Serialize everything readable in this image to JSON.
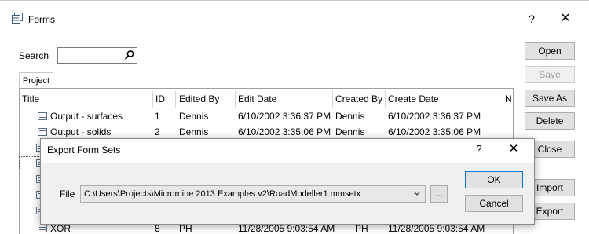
{
  "window": {
    "title": "Forms",
    "help": "?",
    "close": "✕"
  },
  "search": {
    "label": "Search",
    "value": ""
  },
  "tabs": [
    {
      "label": "Project"
    }
  ],
  "table": {
    "columns": [
      "Title",
      "ID",
      "Edited By",
      "Edit Date",
      "Created By",
      "Create Date",
      "N"
    ],
    "rows": [
      {
        "title": "Output - surfaces",
        "id": "1",
        "edited_by": "Dennis",
        "edit_date": "6/10/2002 3:36:37 PM",
        "created_by": "Dennis",
        "create_date": "6/10/2002 3:36:37 PM"
      },
      {
        "title": "Output - solids",
        "id": "2",
        "edited_by": "Dennis",
        "edit_date": "6/10/2002 3:35:06 PM",
        "created_by": "Dennis",
        "create_date": "6/10/2002 3:35:06 PM"
      },
      {
        "title": "XOR",
        "id": "8",
        "edited_by": "PH",
        "edit_date": "11/28/2005 9:03:54 AM",
        "created_by": "PH",
        "create_date": "11/28/2005 9:03:54 AM"
      }
    ]
  },
  "buttons": {
    "open": "Open",
    "save": "Save",
    "save_as": "Save As",
    "delete": "Delete",
    "close": "Close",
    "import": "Import",
    "export": "Export"
  },
  "dialog": {
    "title": "Export Form Sets",
    "help": "?",
    "close": "✕",
    "file_label": "File",
    "file_value": "C:\\Users\\Projects\\Micromine 2013 Examples v2\\RoadModeller1.mmsetx",
    "browse": "...",
    "ok": "OK",
    "cancel": "Cancel"
  }
}
